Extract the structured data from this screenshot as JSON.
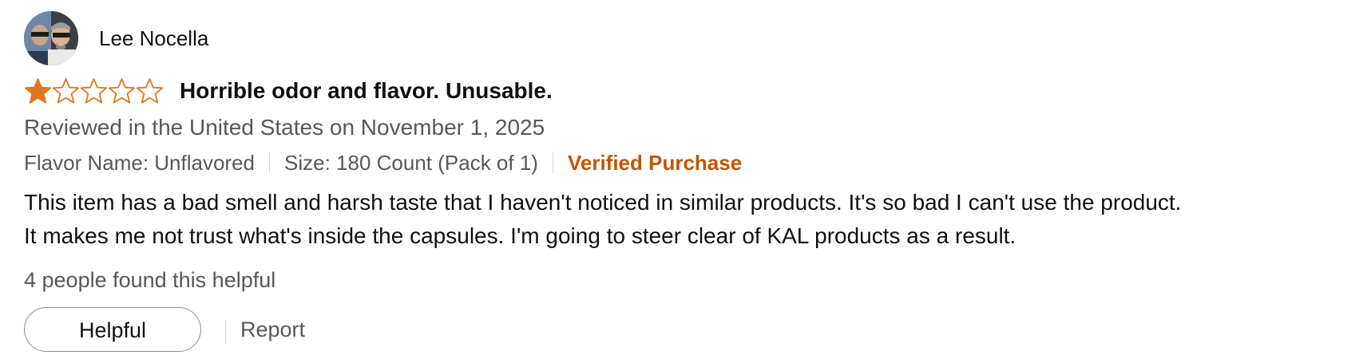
{
  "review": {
    "reviewer_name": "Lee Nocella",
    "rating": 1,
    "rating_max": 5,
    "title": "Horrible odor and flavor. Unusable.",
    "date_line": "Reviewed in the United States on November 1, 2025",
    "flavor": "Flavor Name: Unflavored",
    "size": "Size: 180 Count (Pack of 1)",
    "verified": "Verified Purchase",
    "body_lines": [
      "This item has a bad smell and harsh taste that I haven't noticed in similar products. It's so bad I can't use the product.",
      "It makes me not trust what's inside the capsules. I'm going to steer clear of KAL products as a result."
    ],
    "helpful_count": "4 people found this helpful",
    "helpful_button": "Helpful",
    "report_link": "Report"
  },
  "colors": {
    "star_fill": "#de7921",
    "verified": "#c45500",
    "muted_text": "#565959"
  },
  "icons": {
    "star_filled": "star-filled-icon",
    "star_empty": "star-empty-icon"
  }
}
